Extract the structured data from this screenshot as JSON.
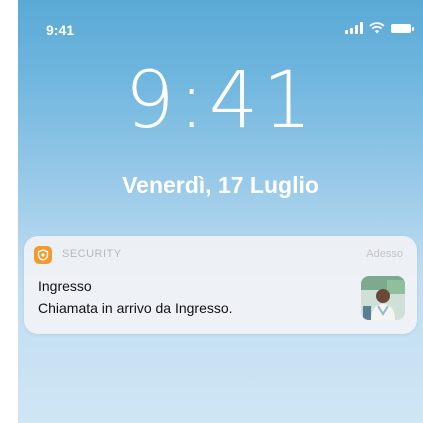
{
  "status_bar": {
    "time": "9:41",
    "signal_icon": "cellular-signal-icon",
    "wifi_icon": "wifi-icon",
    "battery_icon": "battery-icon"
  },
  "lock_screen": {
    "time": "9:41",
    "date": "Venerdì, 17 Luglio"
  },
  "notification": {
    "app_icon": "security-shield-icon",
    "app_name": "SECURITY",
    "time": "Adesso",
    "title": "Ingresso",
    "body": "Chiamata in arrivo da Ingresso.",
    "thumbnail_icon": "caller-photo-thumbnail",
    "accent_color": "#f29a2e"
  }
}
